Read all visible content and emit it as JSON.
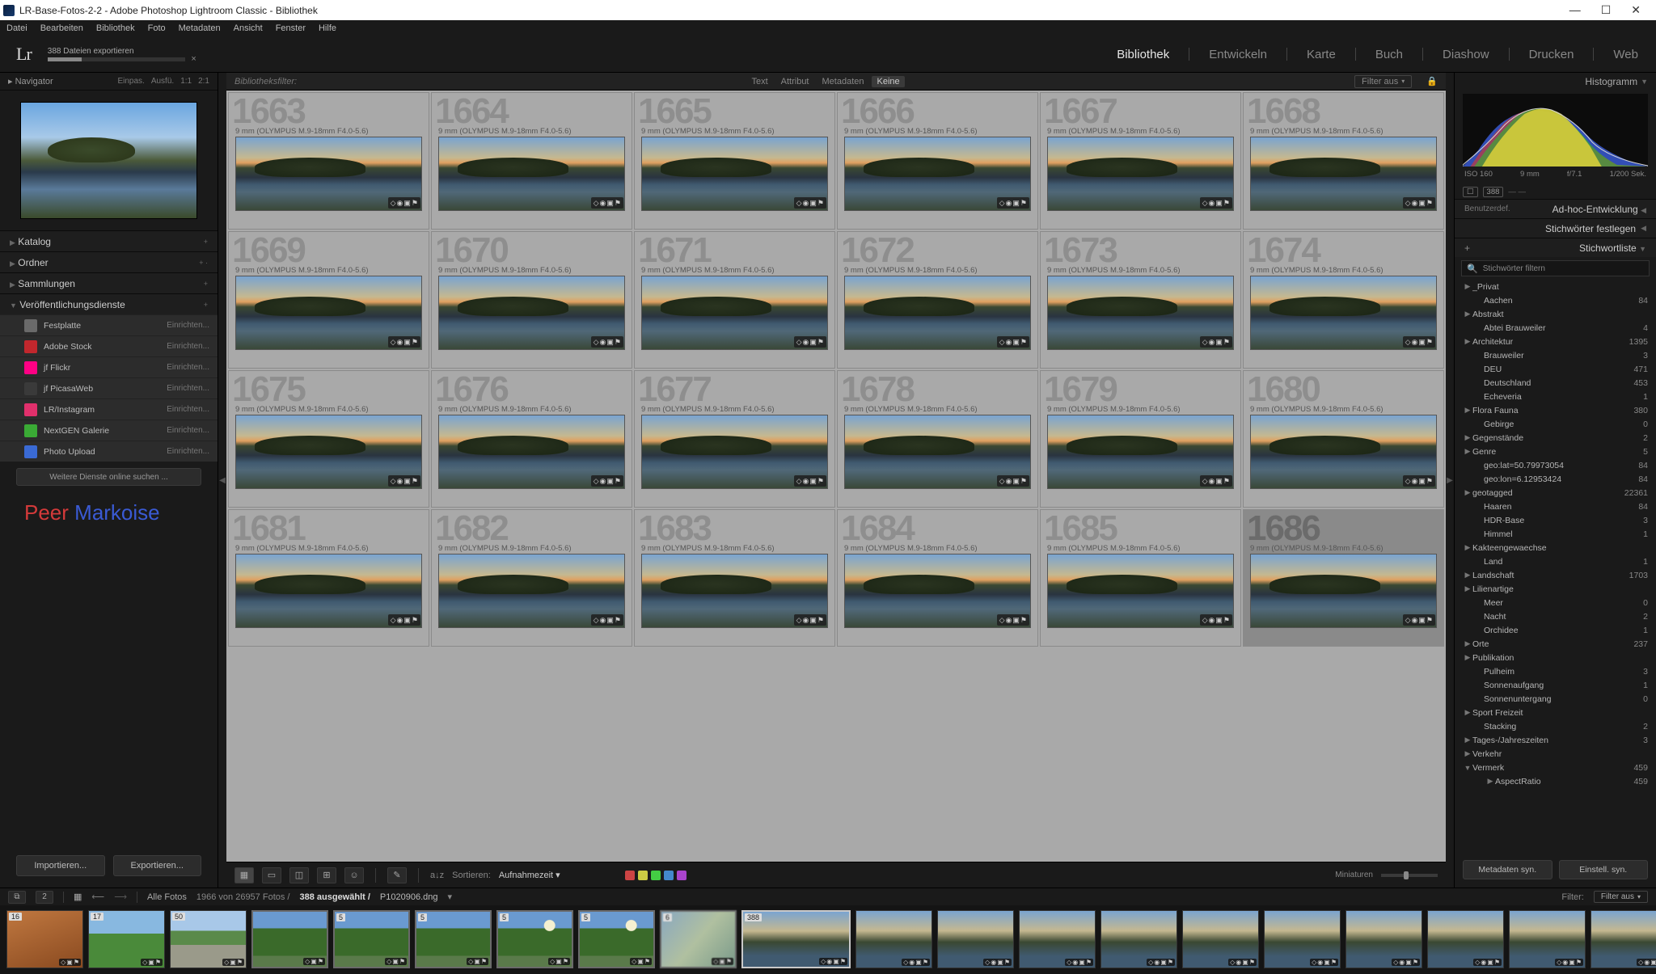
{
  "window": {
    "title": "LR-Base-Fotos-2-2 - Adobe Photoshop Lightroom Classic - Bibliothek"
  },
  "menubar": [
    "Datei",
    "Bearbeiten",
    "Bibliothek",
    "Foto",
    "Metadaten",
    "Ansicht",
    "Fenster",
    "Hilfe"
  ],
  "progress": {
    "label": "388 Dateien exportieren"
  },
  "modules": {
    "items": [
      "Bibliothek",
      "Entwickeln",
      "Karte",
      "Buch",
      "Diashow",
      "Drucken",
      "Web"
    ],
    "active": "Bibliothek"
  },
  "left": {
    "navigator": {
      "title": "Navigator",
      "opts": [
        "Einpas.",
        "Ausfü.",
        "1:1",
        "2:1"
      ]
    },
    "sections": {
      "catalog": "Katalog",
      "folders": "Ordner",
      "collections": "Sammlungen",
      "publish": "Veröffentlichungsdienste"
    },
    "publish_services": [
      {
        "name": "Festplatte",
        "setup": "Einrichten...",
        "color": "#6a6a6a"
      },
      {
        "name": "Adobe Stock",
        "setup": "Einrichten...",
        "color": "#c1272d"
      },
      {
        "name": "jf Flickr",
        "setup": "Einrichten...",
        "color": "#ff0084"
      },
      {
        "name": "jf PicasaWeb",
        "setup": "Einrichten...",
        "color": "#3a3a3a"
      },
      {
        "name": "LR/Instagram",
        "setup": "Einrichten...",
        "color": "#e1306c"
      },
      {
        "name": "NextGEN Galerie",
        "setup": "Einrichten...",
        "color": "#3aaa35"
      },
      {
        "name": "Photo Upload",
        "setup": "Einrichten...",
        "color": "#3a6ad4"
      }
    ],
    "more_services": "Weitere Dienste online suchen ...",
    "buttons": {
      "import": "Importieren...",
      "export": "Exportieren..."
    },
    "identity": {
      "part1": "Peer ",
      "part2": "Markoise"
    }
  },
  "filterbar": {
    "label": "Bibliotheksfilter:",
    "tabs": [
      "Text",
      "Attribut",
      "Metadaten",
      "Keine"
    ],
    "active": "Keine",
    "filter_off": "Filter aus"
  },
  "grid": {
    "lens_meta": "9 mm (OLYMPUS M.9-18mm F4.0-5.6)",
    "start_index": 1663,
    "count": 24,
    "selected_index": 1686
  },
  "toolbar": {
    "sort_label": "Sortieren:",
    "sort_value": "Aufnahmezeit",
    "colors": [
      "#c44",
      "#cc4",
      "#4c4",
      "#48c",
      "#a4c"
    ],
    "thumbs_label": "Miniaturen"
  },
  "right": {
    "histogram_title": "Histogramm",
    "histo_meta": {
      "iso": "ISO 160",
      "focal": "9 mm",
      "aperture": "f/7.1",
      "shutter": "1/200 Sek."
    },
    "histo_badge_count": "388",
    "sections": {
      "quickdev_left": "Benutzerdef.",
      "quickdev": "Ad-hoc-Entwicklung",
      "keywording": "Stichwörter festlegen",
      "keywordlist": "Stichwortliste"
    },
    "kw_filter_placeholder": "Stichwörter filtern",
    "keywords": [
      {
        "n": "_Privat",
        "c": "",
        "a": "▶",
        "lvl": 0
      },
      {
        "n": "Aachen",
        "c": "84",
        "a": "",
        "lvl": 1
      },
      {
        "n": "Abstrakt",
        "c": "",
        "a": "▶",
        "lvl": 0
      },
      {
        "n": "Abtei Brauweiler",
        "c": "4",
        "a": "",
        "lvl": 1
      },
      {
        "n": "Architektur",
        "c": "1395",
        "a": "▶",
        "lvl": 0
      },
      {
        "n": "Brauweiler",
        "c": "3",
        "a": "",
        "lvl": 1
      },
      {
        "n": "DEU",
        "c": "471",
        "a": "",
        "lvl": 1
      },
      {
        "n": "Deutschland",
        "c": "453",
        "a": "",
        "lvl": 1
      },
      {
        "n": "Echeveria",
        "c": "1",
        "a": "",
        "lvl": 1
      },
      {
        "n": "Flora Fauna",
        "c": "380",
        "a": "▶",
        "lvl": 0
      },
      {
        "n": "Gebirge",
        "c": "0",
        "a": "",
        "lvl": 1
      },
      {
        "n": "Gegenstände",
        "c": "2",
        "a": "▶",
        "lvl": 0
      },
      {
        "n": "Genre",
        "c": "5",
        "a": "▶",
        "lvl": 0
      },
      {
        "n": "geo:lat=50.79973054",
        "c": "84",
        "a": "",
        "lvl": 1
      },
      {
        "n": "geo:lon=6.12953424",
        "c": "84",
        "a": "",
        "lvl": 1
      },
      {
        "n": "geotagged",
        "c": "22361",
        "a": "▶",
        "lvl": 0
      },
      {
        "n": "Haaren",
        "c": "84",
        "a": "",
        "lvl": 1
      },
      {
        "n": "HDR-Base",
        "c": "3",
        "a": "",
        "lvl": 1
      },
      {
        "n": "Himmel",
        "c": "1",
        "a": "",
        "lvl": 1
      },
      {
        "n": "Kakteengewaechse",
        "c": "",
        "a": "▶",
        "lvl": 0
      },
      {
        "n": "Land",
        "c": "1",
        "a": "",
        "lvl": 1
      },
      {
        "n": "Landschaft",
        "c": "1703",
        "a": "▶",
        "lvl": 0
      },
      {
        "n": "Lilienartige",
        "c": "",
        "a": "▶",
        "lvl": 0
      },
      {
        "n": "Meer",
        "c": "0",
        "a": "",
        "lvl": 1
      },
      {
        "n": "Nacht",
        "c": "2",
        "a": "",
        "lvl": 1
      },
      {
        "n": "Orchidee",
        "c": "1",
        "a": "",
        "lvl": 1
      },
      {
        "n": "Orte",
        "c": "237",
        "a": "▶",
        "lvl": 0
      },
      {
        "n": "Publikation",
        "c": "",
        "a": "▶",
        "lvl": 0
      },
      {
        "n": "Pulheim",
        "c": "3",
        "a": "",
        "lvl": 1
      },
      {
        "n": "Sonnenaufgang",
        "c": "1",
        "a": "",
        "lvl": 1
      },
      {
        "n": "Sonnenuntergang",
        "c": "0",
        "a": "",
        "lvl": 1
      },
      {
        "n": "Sport Freizeit",
        "c": "",
        "a": "▶",
        "lvl": 0
      },
      {
        "n": "Stacking",
        "c": "2",
        "a": "",
        "lvl": 1
      },
      {
        "n": "Tages-/Jahreszeiten",
        "c": "3",
        "a": "▶",
        "lvl": 0
      },
      {
        "n": "Verkehr",
        "c": "",
        "a": "▶",
        "lvl": 0
      },
      {
        "n": "Vermerk",
        "c": "459",
        "a": "▼",
        "lvl": 0
      },
      {
        "n": "AspectRatio",
        "c": "459",
        "a": "▶",
        "lvl": 2
      }
    ],
    "buttons": {
      "sync_meta": "Metadaten syn.",
      "sync_settings": "Einstell. syn."
    }
  },
  "secondbar": {
    "source": "Alle Fotos",
    "counts": "1966 von 26957 Fotos /",
    "selected": "388 ausgewählt /",
    "filename": "P1020906.dng",
    "filter_label": "Filter:",
    "filter_value": "Filter aus"
  },
  "filmstrip": {
    "stacks": [
      {
        "cnt": "16",
        "cls": "orange"
      },
      {
        "cnt": "17",
        "cls": "green"
      },
      {
        "cnt": "50",
        "cls": "path"
      },
      {
        "cnt": "",
        "cls": "trees stackframe"
      },
      {
        "cnt": "5",
        "cls": "trees stackframe"
      },
      {
        "cnt": "5",
        "cls": "trees stackframe"
      },
      {
        "cnt": "5",
        "cls": "treessun stackframe"
      },
      {
        "cnt": "5",
        "cls": "treessun stackframe"
      },
      {
        "cnt": "6",
        "cls": "blur stackframe"
      }
    ],
    "selected_count": "388",
    "lakes": 10
  }
}
